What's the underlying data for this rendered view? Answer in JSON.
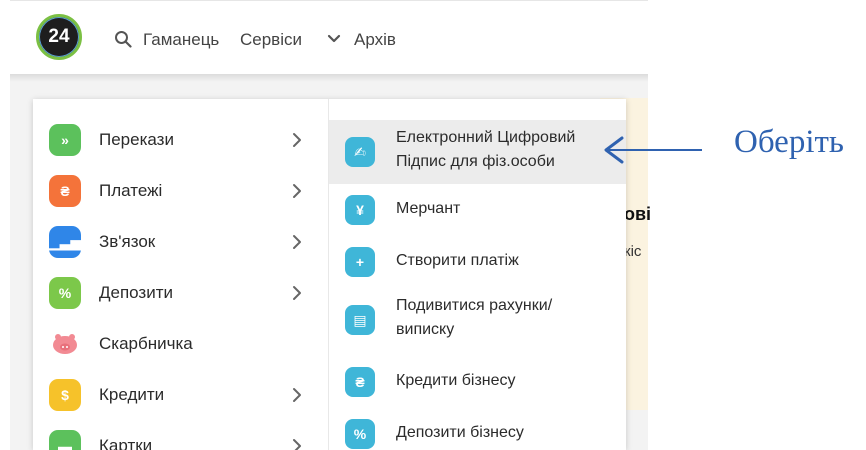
{
  "header": {
    "logo_text": "24",
    "nav": [
      {
        "label": "Гаманець"
      },
      {
        "label": "Сервіси"
      },
      {
        "label": "Архів"
      }
    ]
  },
  "background": {
    "heading_fragment": "ові",
    "text_fragment": "кіс"
  },
  "menu": {
    "left": [
      {
        "label": "Перекази",
        "icon": "chevrons-right-icon",
        "color": "#5cc15c",
        "glyph": "»",
        "has_submenu": true
      },
      {
        "label": "Платежі",
        "icon": "invoice-icon",
        "color": "#f4733a",
        "glyph": "₴",
        "has_submenu": true
      },
      {
        "label": "Зв'язок",
        "icon": "signal-icon",
        "color": "#2f86e8",
        "glyph": "▁▃▅",
        "has_submenu": true
      },
      {
        "label": "Депозити",
        "icon": "percent-icon",
        "color": "#7cc84a",
        "glyph": "%",
        "has_submenu": true
      },
      {
        "label": "Скарбничка",
        "icon": "piggy-bank-icon",
        "color": "#f28a93",
        "glyph": "",
        "has_submenu": false
      },
      {
        "label": "Кредити",
        "icon": "money-bag-icon",
        "color": "#f6c22a",
        "glyph": "$",
        "has_submenu": true
      },
      {
        "label": "Картки",
        "icon": "card-icon",
        "color": "#5cc15c",
        "glyph": "▬",
        "has_submenu": true
      }
    ],
    "right": [
      {
        "label": "Електронний Цифровий Підпис для фіз.особи",
        "icon": "signature-icon",
        "glyph": "✍",
        "selected": true
      },
      {
        "label": "Мерчант",
        "icon": "merchant-icon",
        "glyph": "¥",
        "selected": false
      },
      {
        "label": "Створити платіж",
        "icon": "plus-icon",
        "glyph": "+",
        "selected": false
      },
      {
        "label": "Подивитися рахунки/виписку",
        "icon": "statement-icon",
        "glyph": "▤",
        "selected": false
      },
      {
        "label": "Кредити бізнесу",
        "icon": "business-credit-icon",
        "glyph": "₴",
        "selected": false
      },
      {
        "label": "Депозити бізнесу",
        "icon": "business-deposit-icon",
        "glyph": "%",
        "selected": false
      }
    ]
  },
  "annotation": {
    "text": "Оберіть",
    "color": "#2f62b0"
  }
}
